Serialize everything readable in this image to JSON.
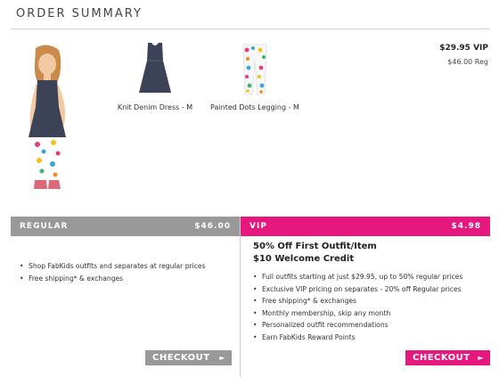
{
  "title": "ORDER SUMMARY",
  "products": [
    {
      "name": "Knit Denim Dress - M",
      "image": "dress-icon"
    },
    {
      "name": "Painted Dots Legging - M",
      "image": "legging-icon"
    }
  ],
  "pricing": {
    "vip": "$29.95 VIP",
    "regular": "$46.00 Reg"
  },
  "regular_plan": {
    "label": "REGULAR",
    "amount": "$46.00",
    "features": [
      "Shop FabKids outfits and separates at regular prices",
      "Free shipping* & exchanges"
    ],
    "checkout": "CHECKOUT"
  },
  "vip_plan": {
    "label": "VIP",
    "amount": "$4.98",
    "headline1": "50% Off First Outfit/Item",
    "headline2": "$10 Welcome Credit",
    "features": [
      "Full outfits starting at just $29.95, up to 50% regular prices",
      "Exclusive VIP pricing on separates - 20% off Regular prices",
      "Free shipping* & exchanges",
      "Monthly membership, skip any month",
      "Personalized outfit recommendations",
      "Earn FabKids Reward Points"
    ],
    "checkout": "CHECKOUT"
  },
  "colors": {
    "accent": "#e6177d",
    "regular": "#999999"
  }
}
